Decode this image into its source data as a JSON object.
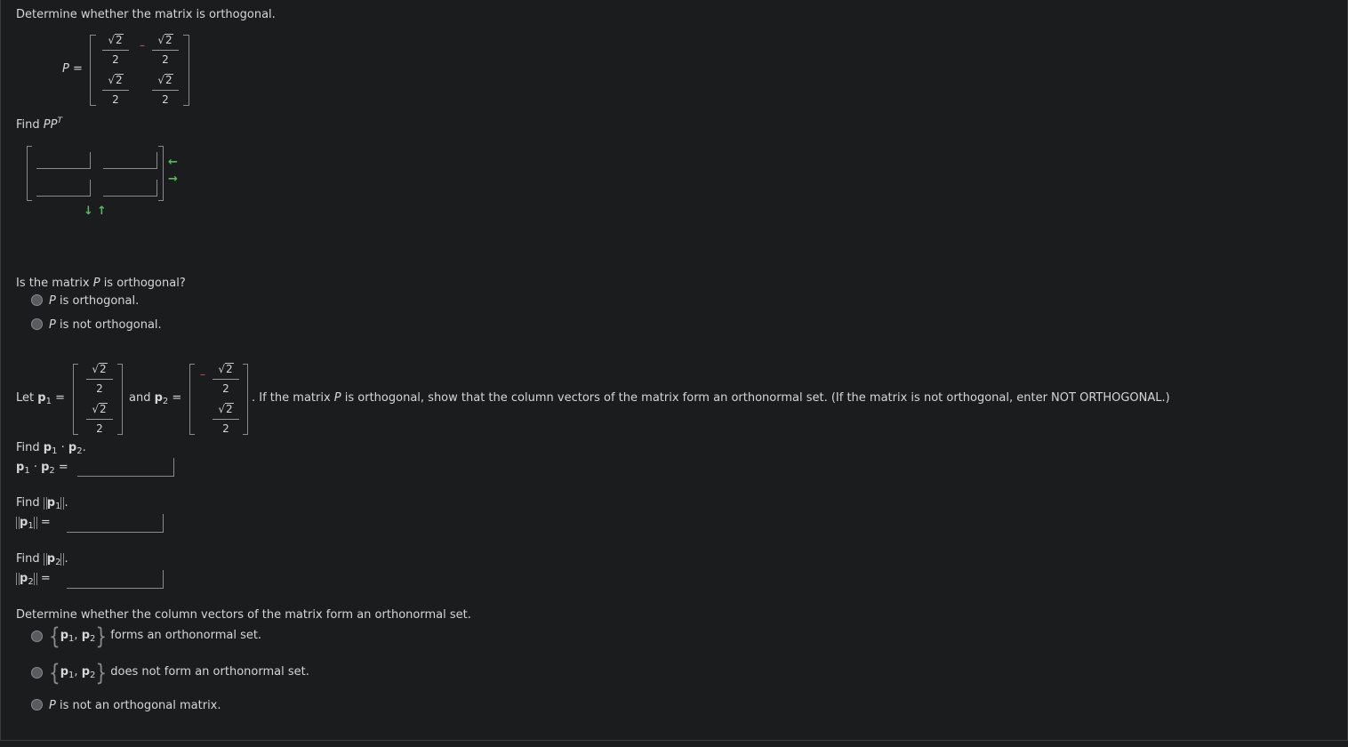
{
  "q1_prompt": "Determine whether the matrix is orthogonal.",
  "matrix_label": "P =",
  "matrix": {
    "sqrt_num": "2",
    "den": "2",
    "neg_sign": "–"
  },
  "find_ppt_label": "Find ",
  "find_ppt_expr": "PP",
  "find_ppt_sup": "T",
  "is_orthogonal_question_a": "Is the matrix ",
  "is_orthogonal_question_p": "P",
  "is_orthogonal_question_b": " is orthogonal?",
  "ortho_options": [
    {
      "p": "P",
      "text": " is orthogonal."
    },
    {
      "p": "P",
      "text": " is not orthogonal."
    }
  ],
  "let_text": "Let ",
  "p1_label": "p",
  "p1_sub": "1",
  "and_text": "and ",
  "eq": "=",
  "instruction_a": ". If the matrix ",
  "instruction_p": "P",
  "instruction_b": " is orthogonal, show that the column vectors of the matrix form an orthonormal set. (If the matrix is not orthogonal, enter NOT ORTHOGONAL.)",
  "find_text": "Find ",
  "dot": " · ",
  "period": ".",
  "sub1": "1",
  "sub2": "2",
  "q_set_prompt": "Determine whether the column vectors of the matrix form an orthonormal set.",
  "set_options": [
    {
      "text": " forms an orthonormal set."
    },
    {
      "text": " does not form an orthonormal set."
    },
    {
      "p": "P",
      "text": " is not an orthogonal matrix."
    }
  ],
  "inputs": {
    "pp_t": [
      "",
      "",
      "",
      ""
    ],
    "dot_product": "",
    "norm_p1": "",
    "norm_p2": ""
  },
  "icons": {
    "row_swap_up": "left-arrow-icon",
    "row_swap_down": "right-arrow-icon",
    "col_down": "down-arrow-icon",
    "col_up": "up-arrow-icon"
  }
}
